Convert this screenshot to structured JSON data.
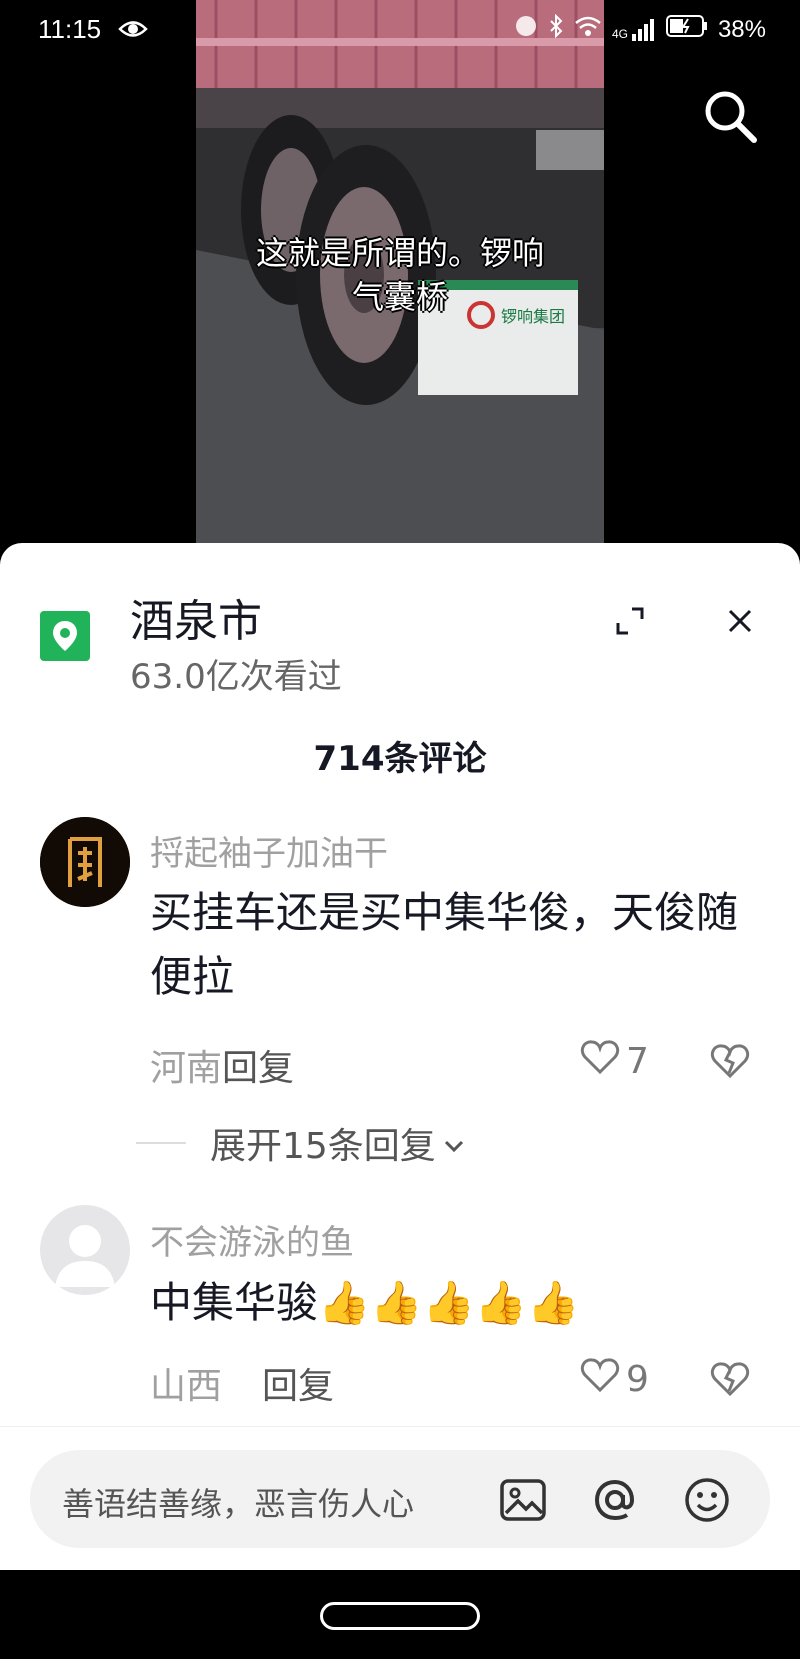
{
  "status_bar": {
    "time": "11:15",
    "network": "4G",
    "battery": "38%",
    "icons": [
      "eye-icon",
      "alarm-icon",
      "bluetooth-icon",
      "wifi-icon",
      "signal-icon",
      "battery-icon"
    ]
  },
  "video": {
    "subtitle_line1": "这就是所谓的。锣响",
    "subtitle_line2": "气囊桥",
    "sign_text": "锣响集团",
    "search_icon": "search-icon"
  },
  "location": {
    "name": "酒泉市",
    "views": "63.0亿次看过",
    "icon": "map-pin-icon"
  },
  "comments_header": {
    "count": "714条评论"
  },
  "comments": [
    {
      "user": "捋起袖子加油干",
      "text": "买挂车还是买中集华俊，天俊随便拉",
      "region": "河南",
      "reply_label": "回复",
      "likes": "7",
      "expand_label": "展开15条回复"
    },
    {
      "user": "不会游泳的鱼",
      "text": "中集华骏",
      "emoji": "👍👍👍👍👍",
      "region": "山西",
      "reply_label": "回复",
      "likes": "9"
    }
  ],
  "input_bar": {
    "placeholder": "善语结善缘，恶言伤人心"
  },
  "colors": {
    "location_green": "#21b35a",
    "text_primary": "#161823",
    "text_secondary": "#a0a0a0"
  }
}
